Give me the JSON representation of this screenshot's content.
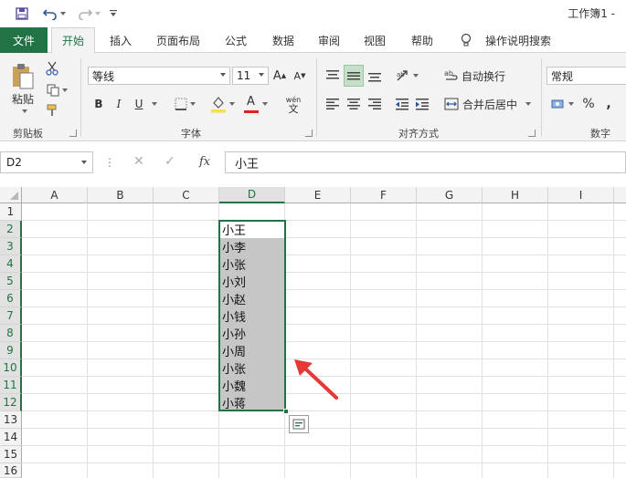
{
  "quick_access": {
    "save_icon": "save-icon",
    "undo_icon": "undo-icon",
    "redo_icon": "redo-icon",
    "customize_icon": "customize-icon"
  },
  "window": {
    "title": "工作簿1 -"
  },
  "tabs": [
    {
      "label": "文件"
    },
    {
      "label": "开始"
    },
    {
      "label": "插入"
    },
    {
      "label": "页面布局"
    },
    {
      "label": "公式"
    },
    {
      "label": "数据"
    },
    {
      "label": "审阅"
    },
    {
      "label": "视图"
    },
    {
      "label": "帮助"
    },
    {
      "label": "操作说明搜索"
    }
  ],
  "ribbon": {
    "clipboard": {
      "paste_label": "粘贴",
      "group_label": "剪贴板"
    },
    "font": {
      "font_name": "等线",
      "font_size": "11",
      "group_label": "字体",
      "bold": "B",
      "italic": "I",
      "underline": "U",
      "grow": "A",
      "shrink": "A",
      "font_color": "A",
      "phonetic": "wén"
    },
    "alignment": {
      "wrap_text": "自动换行",
      "merge_center": "合并后居中",
      "group_label": "对齐方式"
    },
    "number": {
      "format": "常规",
      "percent": "%",
      "comma": ",",
      "group_label": "数字"
    },
    "colors": {
      "accent": "#217346",
      "font_red": "#e02020",
      "highlight_yellow": "#f5e04a"
    }
  },
  "formula_bar": {
    "name_box": "D2",
    "cancel": "✕",
    "enter": "✓",
    "fx": "fx",
    "value": "小王"
  },
  "grid": {
    "columns": [
      "A",
      "B",
      "C",
      "D",
      "E",
      "F",
      "G",
      "H",
      "I"
    ],
    "rows": [
      "1",
      "2",
      "3",
      "4",
      "5",
      "6",
      "7",
      "8",
      "9",
      "10",
      "11",
      "12",
      "13",
      "14",
      "15",
      "16"
    ],
    "selected_column": "D",
    "column_d_values": [
      "小王",
      "小李",
      "小张",
      "小刘",
      "小赵",
      "小钱",
      "小孙",
      "小周",
      "小张",
      "小魏",
      "小蒋"
    ]
  }
}
